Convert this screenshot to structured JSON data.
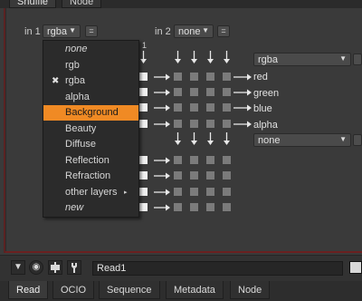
{
  "top_tabs": [
    "Shuffle",
    "Node"
  ],
  "input1": {
    "label": "in 1",
    "value": "rgba",
    "eq": "="
  },
  "input2": {
    "label": "in 2",
    "value": "none",
    "eq": "="
  },
  "column_number": "1",
  "outputs": {
    "top": {
      "value": "rgba"
    },
    "bottom": {
      "value": "none"
    },
    "channels": [
      "red",
      "green",
      "blue",
      "alpha"
    ]
  },
  "menu": {
    "items": [
      {
        "label": "none",
        "italic": true
      },
      {
        "label": "rgb"
      },
      {
        "label": "rgba",
        "checked": true,
        "check": "✖"
      },
      {
        "label": "alpha"
      },
      {
        "label": "Background",
        "highlighted": true
      },
      {
        "label": "Beauty"
      },
      {
        "label": "Diffuse"
      },
      {
        "label": "Reflection"
      },
      {
        "label": "Refraction"
      },
      {
        "label": "other layers",
        "submenu": true,
        "submenu_arrow": "▸"
      },
      {
        "label": "new",
        "italic": true
      }
    ]
  },
  "node_name": "Read1",
  "bottom_tabs": [
    "Read",
    "OCIO",
    "Sequence",
    "Metadata",
    "Node"
  ],
  "active_bottom_tab": "Read",
  "icons": {
    "eye": "◉",
    "wrench": "wrench-icon"
  },
  "colors": {
    "highlight": "#f08a24",
    "border_red": "#6b2020"
  }
}
